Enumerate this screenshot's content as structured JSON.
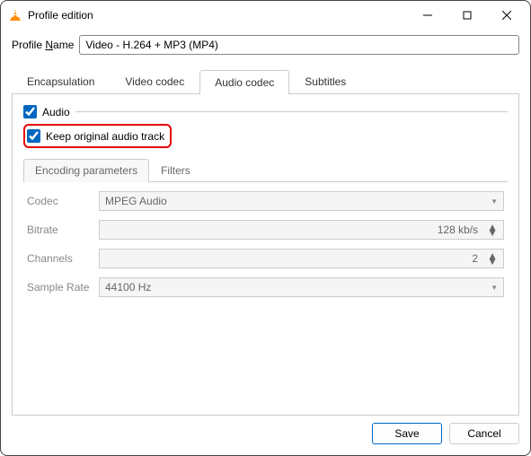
{
  "window": {
    "title": "Profile edition"
  },
  "profile": {
    "label_prefix": "Profile ",
    "label_underline": "N",
    "label_suffix": "ame",
    "value": "Video - H.264 + MP3 (MP4)"
  },
  "main_tabs": [
    "Encapsulation",
    "Video codec",
    "Audio codec",
    "Subtitles"
  ],
  "audio": {
    "enable_label": "Audio",
    "keep_original_label": "Keep original audio track"
  },
  "sub_tabs": [
    "Encoding parameters",
    "Filters"
  ],
  "fields": {
    "codec": {
      "label": "Codec",
      "value": "MPEG Audio"
    },
    "bitrate": {
      "label": "Bitrate",
      "value": "128 kb/s"
    },
    "channels": {
      "label": "Channels",
      "value": "2"
    },
    "samplerate": {
      "label": "Sample Rate",
      "value": "44100 Hz"
    }
  },
  "buttons": {
    "save": "Save",
    "cancel": "Cancel"
  }
}
